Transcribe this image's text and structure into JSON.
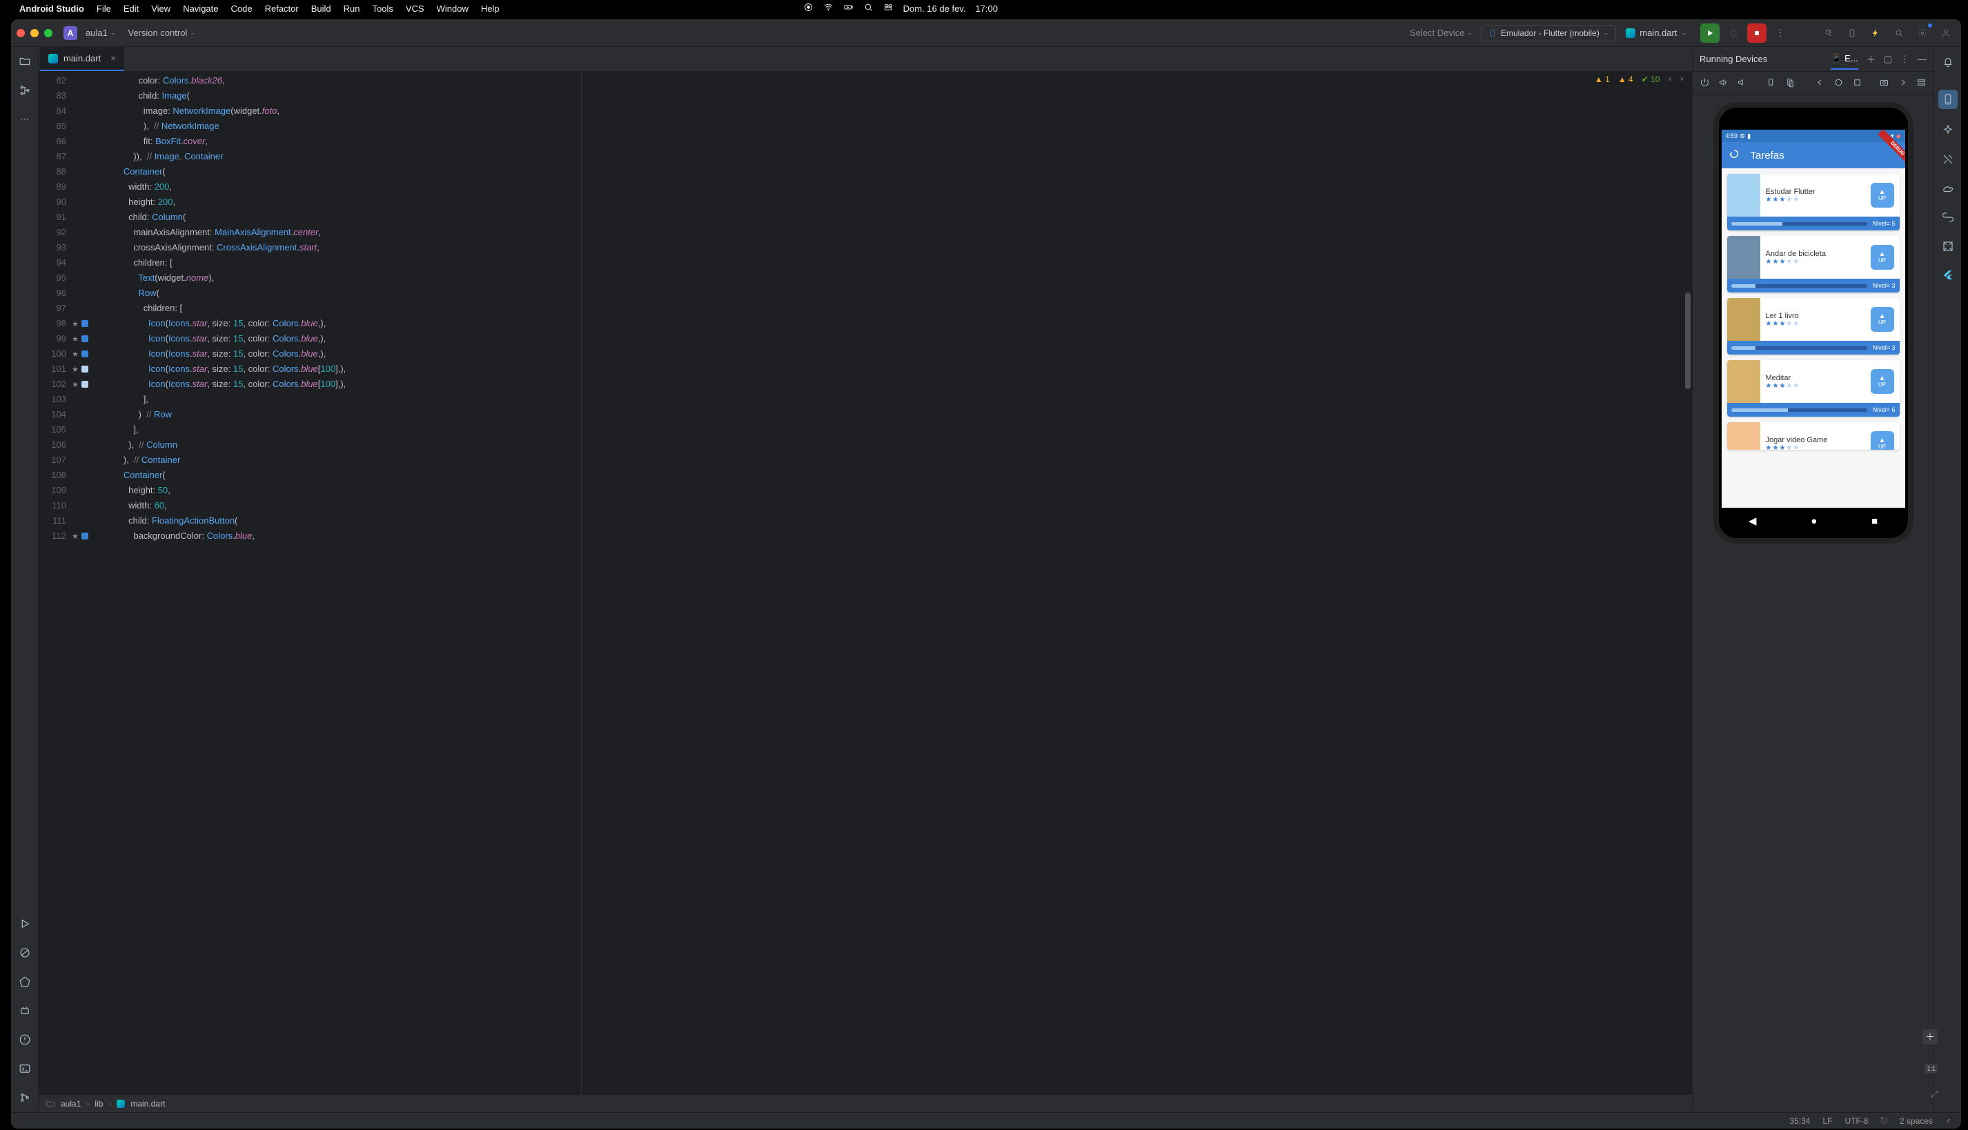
{
  "menubar": {
    "app": "Android Studio",
    "items": [
      "File",
      "Edit",
      "View",
      "Navigate",
      "Code",
      "Refactor",
      "Build",
      "Run",
      "Tools",
      "VCS",
      "Window",
      "Help"
    ],
    "date": "Dom. 16 de fev.",
    "time": "17:00"
  },
  "titlebar": {
    "project_initial": "A",
    "project": "aula1",
    "vcs": "Version control",
    "select_device": "Select Device",
    "device": "Emulador - Flutter (mobile)",
    "current_file": "main.dart"
  },
  "tabs": {
    "file": "main.dart"
  },
  "inspections": {
    "warn1": "1",
    "warn2": "4",
    "pass": "10"
  },
  "gutter": {
    "start": 82,
    "end": 112,
    "bookmarks": [
      98,
      99,
      100,
      101,
      102,
      112
    ],
    "swatches": {
      "98": "#3b82d6",
      "99": "#3b82d6",
      "100": "#3b82d6",
      "101": "#bcd4ef",
      "102": "#bcd4ef",
      "112": "#3b82d6"
    }
  },
  "code": [
    "              color: Colors.black26,",
    "              child: Image(",
    "                image: NetworkImage(widget.foto,",
    "                ),  // NetworkImage",
    "                fit: BoxFit.cover,",
    "            )),  // Image, Container",
    "        Container(",
    "          width: 200,",
    "          height: 200,",
    "          child: Column(",
    "            mainAxisAlignment: MainAxisAlignment.center,",
    "            crossAxisAlignment: CrossAxisAlignment.start,",
    "            children: [",
    "              Text(widget.nome),",
    "              Row(",
    "                children: [",
    "                  Icon(Icons.star, size: 15, color: Colors.blue,),",
    "                  Icon(Icons.star, size: 15, color: Colors.blue,),",
    "                  Icon(Icons.star, size: 15, color: Colors.blue,),",
    "                  Icon(Icons.star, size: 15, color: Colors.blue[100],),",
    "                  Icon(Icons.star, size: 15, color: Colors.blue[100],),",
    "                ],",
    "              )  // Row",
    "            ],",
    "          ),  // Column",
    "        ),  // Container",
    "        Container(",
    "          height: 50,",
    "          width: 60,",
    "          child: FloatingActionButton(",
    "            backgroundColor: Colors.blue,"
  ],
  "devpanel": {
    "title": "Running Devices",
    "tab": "E..."
  },
  "emulator": {
    "time": "4:59",
    "app_title": "Tarefas",
    "tasks": [
      {
        "name": "Estudar Flutter",
        "stars": 3,
        "level": "Nivel= 5",
        "prog": 38,
        "thumb": "#a4d3f2"
      },
      {
        "name": "Andar de bicicleta",
        "stars": 3,
        "level": "Nivel= 3",
        "prog": 18,
        "thumb": "#6e8dab"
      },
      {
        "name": "Ler 1 livro",
        "stars": 3,
        "level": "Nivel= 3",
        "prog": 18,
        "thumb": "#c7a55b"
      },
      {
        "name": "Meditar",
        "stars": 3,
        "level": "Nivel= 6",
        "prog": 42,
        "thumb": "#d9b26b"
      },
      {
        "name": "Jogar video Game",
        "stars": 3,
        "level": "",
        "prog": 0,
        "thumb": "#f2c18e"
      }
    ],
    "up": "UP",
    "ratio": "1:1"
  },
  "breadcrumb": {
    "p1": "aula1",
    "p2": "lib",
    "p3": "main.dart"
  },
  "status": {
    "pos": "35:34",
    "lf": "LF",
    "enc": "UTF-8",
    "indent": "2 spaces"
  }
}
